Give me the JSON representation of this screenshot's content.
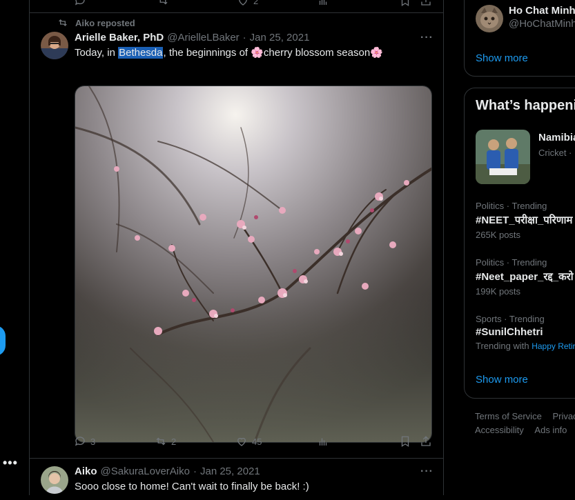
{
  "left_rail": {
    "more_label": "•••"
  },
  "top_actions": {
    "likes": "2"
  },
  "tweet1": {
    "repost_label": "Aiko reposted",
    "author_name": "Arielle Baker, PhD",
    "author_handle": "@ArielleLBaker",
    "separator": "·",
    "date": "Jan 25, 2021",
    "text_before": "Today, in ",
    "text_highlight": "Bethesda",
    "text_after": ", the beginnings of 🌸cherry blossom season🌸",
    "replies": "3",
    "reposts": "2",
    "likes": "45"
  },
  "tweet2": {
    "author_name": "Aiko",
    "author_handle": "@SakuraLoverAiko",
    "separator": "·",
    "date": "Jan 25, 2021",
    "text": "Sooo close to home! Can't wait to finally be back! :)"
  },
  "who_to_follow": {
    "name": "Ho Chat Minh",
    "handle": "@HoChatMinh",
    "show_more": "Show more"
  },
  "whats_happening": {
    "title": "What’s happening",
    "featured": {
      "title": "Namibia",
      "meta": "Cricket ·"
    },
    "trends": [
      {
        "meta": "Politics · Trending",
        "title": "#NEET_परीक्षा_परिणाम",
        "sub": "265K posts"
      },
      {
        "meta": "Politics · Trending",
        "title": "#Neet_paper_रद्द_करो",
        "sub": "199K posts"
      },
      {
        "meta": "Sports · Trending",
        "title": "#SunilChhetri",
        "sub_prefix": "Trending with",
        "sub_link": "Happy Retirement"
      }
    ],
    "show_more": "Show more"
  },
  "footer": {
    "links": [
      "Terms of Service",
      "Privacy",
      "Accessibility",
      "Ads info"
    ]
  },
  "colors": {
    "accent": "#1d9bf0",
    "border": "#2f3336",
    "muted": "#71767b"
  }
}
